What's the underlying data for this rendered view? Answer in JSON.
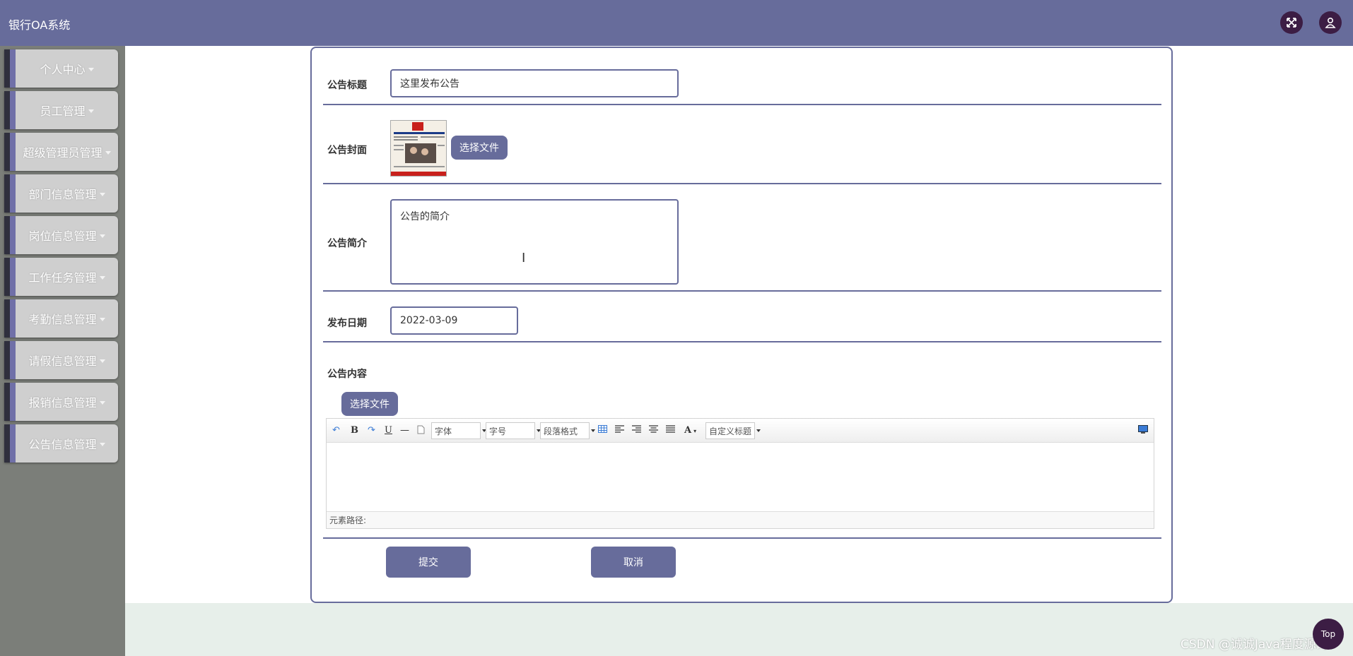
{
  "header": {
    "app_title": "银行OA系统"
  },
  "sidebar": {
    "items": [
      {
        "label": "个人中心"
      },
      {
        "label": "员工管理"
      },
      {
        "label": "超级管理员管理"
      },
      {
        "label": "部门信息管理"
      },
      {
        "label": "岗位信息管理"
      },
      {
        "label": "工作任务管理"
      },
      {
        "label": "考勤信息管理"
      },
      {
        "label": "请假信息管理"
      },
      {
        "label": "报销信息管理"
      },
      {
        "label": "公告信息管理"
      }
    ]
  },
  "form": {
    "title_label": "公告标题",
    "title_value": "这里发布公告",
    "cover_label": "公告封面",
    "cover_button": "选择文件",
    "summary_label": "公告简介",
    "summary_value": "公告的简介",
    "date_label": "发布日期",
    "date_value": "2022-03-09",
    "content_label": "公告内容",
    "content_button": "选择文件"
  },
  "editor": {
    "font_select": "字体",
    "size_select": "字号",
    "paragraph_select": "段落格式",
    "custom_title_select": "自定义标题",
    "status_text": "元素路径:"
  },
  "actions": {
    "submit": "提交",
    "cancel": "取消"
  },
  "floating": {
    "top_button": "Top",
    "watermark": "CSDN @诚诚Java程度源码"
  },
  "colors": {
    "primary": "#676c9b",
    "icon_bg": "#3c1d44",
    "sidebar_bg": "#7b7e79"
  }
}
